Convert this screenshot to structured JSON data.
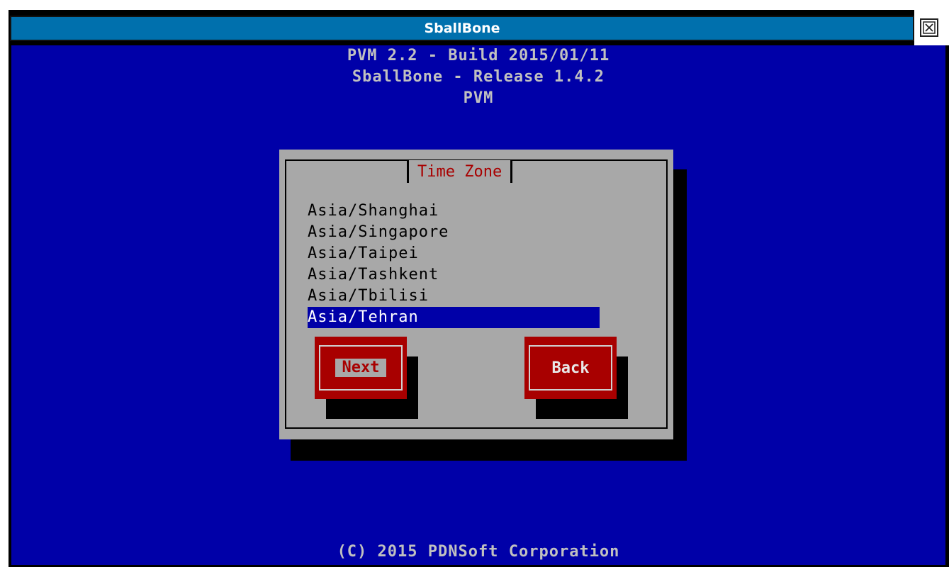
{
  "window": {
    "title": "SballBone",
    "close_label": "×"
  },
  "header": {
    "line1": "PVM 2.2 - Build 2015/01/11",
    "line2": "SballBone - Release 1.4.2",
    "line3": "PVM"
  },
  "dialog": {
    "title": "Time Zone",
    "items": [
      "Asia/Shanghai",
      "Asia/Singapore",
      "Asia/Taipei",
      "Asia/Tashkent",
      "Asia/Tbilisi",
      "Asia/Tehran"
    ],
    "selected_item": "Asia/Tehran",
    "next_label": "Next",
    "back_label": "Back"
  },
  "footer": {
    "copyright": "(C) 2015 PDNSoft Corporation"
  },
  "colors": {
    "screen_bg": "#0000a8",
    "dialog_bg": "#a8a8a8",
    "accent_red": "#a80000",
    "titlebar_blue": "#0070ad"
  },
  "icons": {
    "close": "close-icon"
  }
}
